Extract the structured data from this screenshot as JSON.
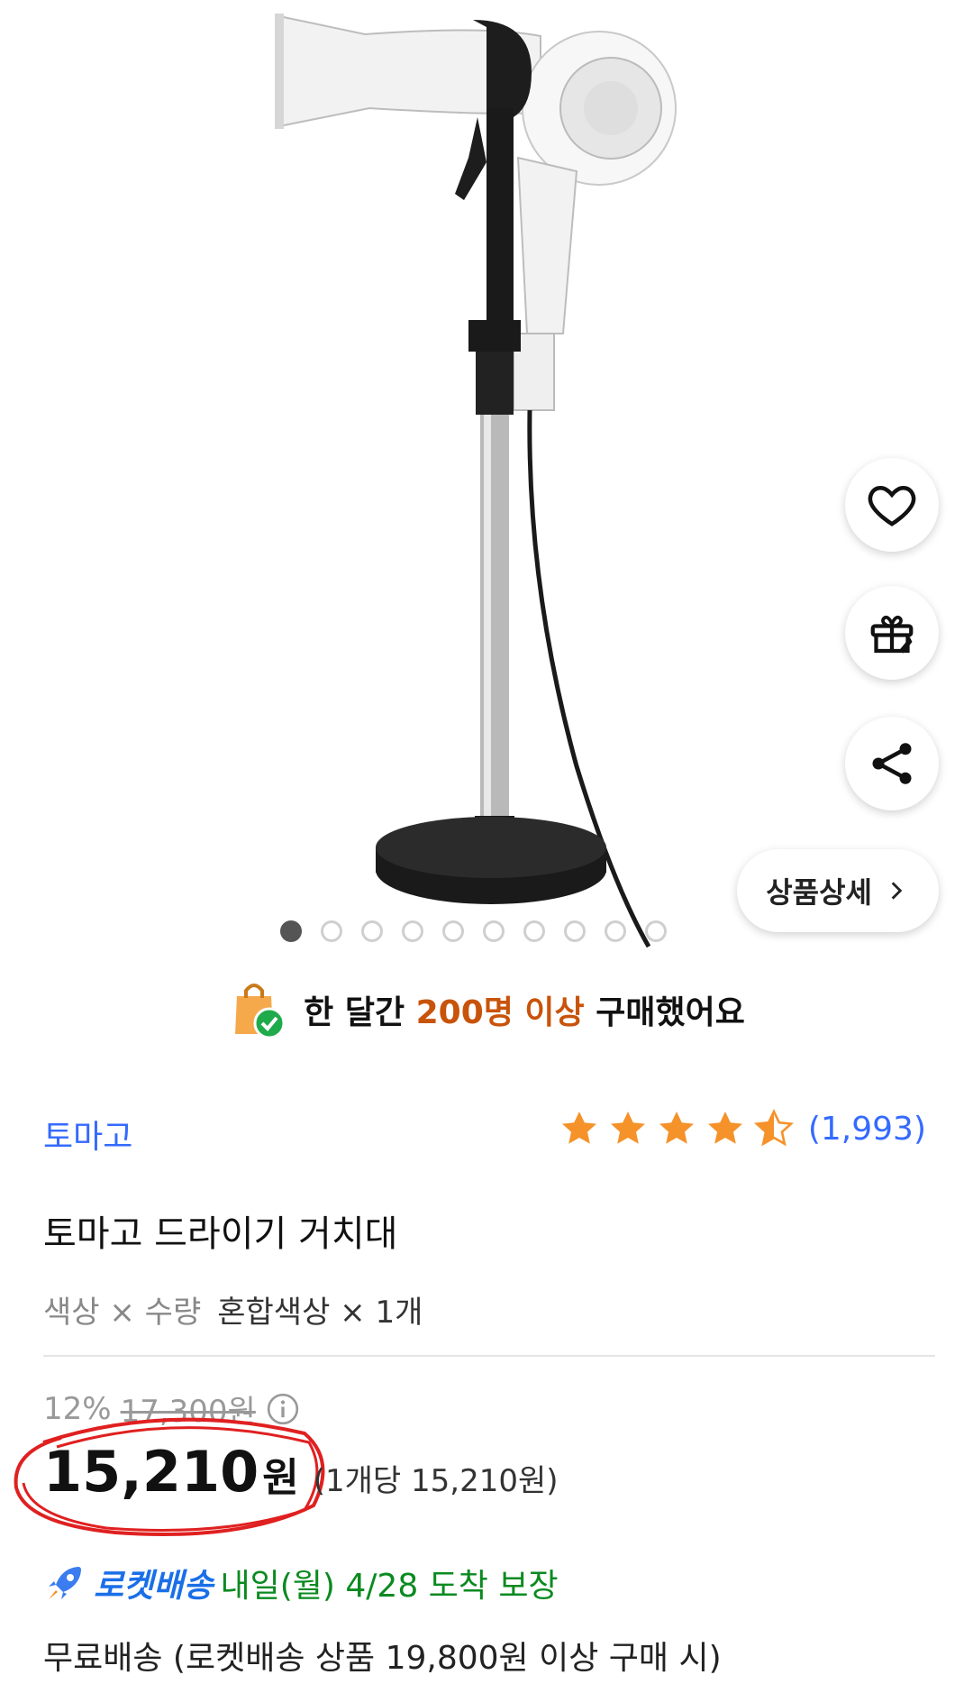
{
  "hero": {
    "image_alt": "드라이기 거치대 제품 이미지",
    "carousel_count": 10,
    "carousel_active_index": 0
  },
  "actions": {
    "wishlist_icon": "heart-icon",
    "gift_icon": "gift-icon",
    "share_icon": "share-icon",
    "detail_label": "상품상세"
  },
  "social_proof": {
    "prefix": "한 달간",
    "highlight": "200명 이상",
    "suffix": "구매했어요"
  },
  "product": {
    "brand": "토마고",
    "rating_stars": 4.5,
    "review_count": "(1,993)",
    "title": "토마고 드라이기 거치대",
    "option_label": "색상 × 수량",
    "option_value": "혼합색상 × 1개"
  },
  "pricing": {
    "discount_percent": "12%",
    "original_price": "17,300원",
    "sale_price": "15,210",
    "currency": "원",
    "unit_price": "(1개당 15,210원)"
  },
  "delivery": {
    "badge": "로켓배송",
    "arrival": "내일(월) 4/28 도착 보장",
    "free_shipping": "무료배송 (로켓배송 상품 19,800원 이상 구매 시)"
  },
  "colors": {
    "link_blue": "#346aff",
    "star_orange": "#f5922a",
    "highlight_orange": "#c8530a",
    "delivery_green": "#0a8a20",
    "annotation_red": "#e02020"
  }
}
